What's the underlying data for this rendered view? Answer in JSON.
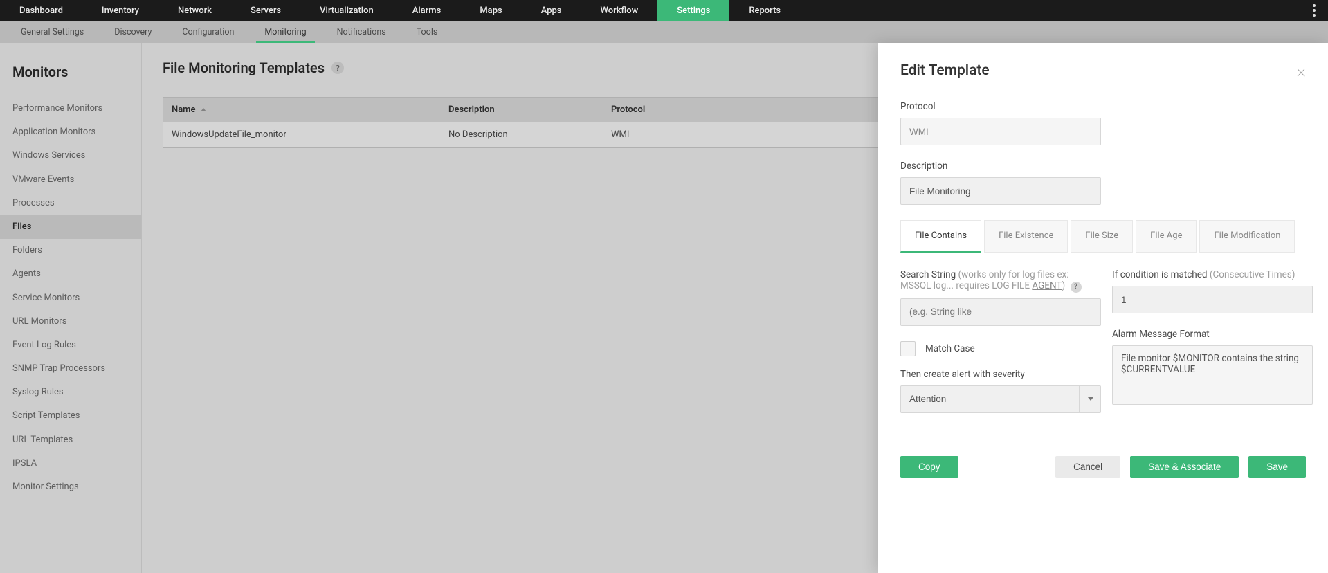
{
  "topnav": {
    "items": [
      "Dashboard",
      "Inventory",
      "Network",
      "Servers",
      "Virtualization",
      "Alarms",
      "Maps",
      "Apps",
      "Workflow",
      "Settings",
      "Reports"
    ],
    "active": "Settings"
  },
  "subnav": {
    "items": [
      "General Settings",
      "Discovery",
      "Configuration",
      "Monitoring",
      "Notifications",
      "Tools"
    ],
    "active": "Monitoring"
  },
  "sidebar": {
    "title": "Monitors",
    "items": [
      "Performance Monitors",
      "Application Monitors",
      "Windows Services",
      "VMware Events",
      "Processes",
      "Files",
      "Folders",
      "Agents",
      "Service Monitors",
      "URL Monitors",
      "Event Log Rules",
      "SNMP Trap Processors",
      "Syslog Rules",
      "Script Templates",
      "URL Templates",
      "IPSLA",
      "Monitor Settings"
    ],
    "active": "Files"
  },
  "page": {
    "title": "File Monitoring Templates"
  },
  "table": {
    "headers": {
      "name": "Name",
      "description": "Description",
      "protocol": "Protocol"
    },
    "rows": [
      {
        "name": "WindowsUpdateFile_monitor",
        "description": "No Description",
        "protocol": "WMI"
      }
    ]
  },
  "panel": {
    "title": "Edit Template",
    "protocol_label": "Protocol",
    "protocol_value": "WMI",
    "description_label": "Description",
    "description_value": "File Monitoring",
    "tabs": [
      "File Contains",
      "File Existence",
      "File Size",
      "File Age",
      "File Modification"
    ],
    "active_tab": "File Contains",
    "search_label": "Search String",
    "search_hint": " (works only for log files ex: MSSQL log... requires LOG FILE ",
    "search_hint_link": "AGENT",
    "search_hint_tail": ")",
    "search_placeholder": "(e.g. String like",
    "matchcase_label": "Match Case",
    "severity_label": "Then create alert with severity",
    "severity_value": "Attention",
    "condition_label": "If condition is matched",
    "condition_hint": " (Consecutive Times)",
    "condition_value": "1",
    "alarm_label": "Alarm Message Format",
    "alarm_value": "File monitor $MONITOR contains the string $CURRENTVALUE",
    "buttons": {
      "copy": "Copy",
      "cancel": "Cancel",
      "save_assoc": "Save & Associate",
      "save": "Save"
    }
  }
}
